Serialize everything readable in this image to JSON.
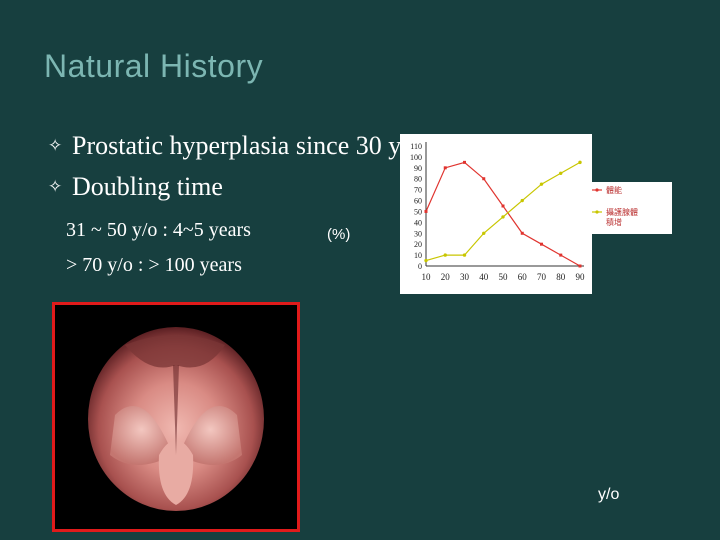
{
  "slide": {
    "title": "Natural History",
    "bullets": [
      "Prostatic hyperplasia since 30 y/o",
      "Doubling time"
    ],
    "bullet_glyph": "✧",
    "details": [
      "31 ~ 50 y/o : 4~5 years",
      "> 70 y/o : > 100 years"
    ],
    "percent_label": "(%)",
    "bottom_unit": "y/o",
    "photo_icon": "endoscopic-view-image",
    "photo_border_color": "#e01b1b"
  },
  "chart_data": {
    "type": "line",
    "x": [
      10,
      20,
      30,
      40,
      50,
      60,
      70,
      80,
      90
    ],
    "xticks": [
      "10",
      "20",
      "30",
      "40",
      "50",
      "60",
      "70",
      "80",
      "90"
    ],
    "ylim": [
      0,
      110
    ],
    "yticks": [
      "0",
      "10",
      "20",
      "30",
      "40",
      "50",
      "60",
      "70",
      "80",
      "90",
      "100",
      "110"
    ],
    "grid": false,
    "legend_placement": "right",
    "series": [
      {
        "name": "體能",
        "color": "#e0342f",
        "values": [
          50,
          90,
          95,
          80,
          55,
          30,
          20,
          10,
          0
        ]
      },
      {
        "name": "攝護腺體積增",
        "color": "#c8c600",
        "values": [
          5,
          10,
          10,
          30,
          45,
          60,
          75,
          85,
          95
        ]
      }
    ]
  }
}
